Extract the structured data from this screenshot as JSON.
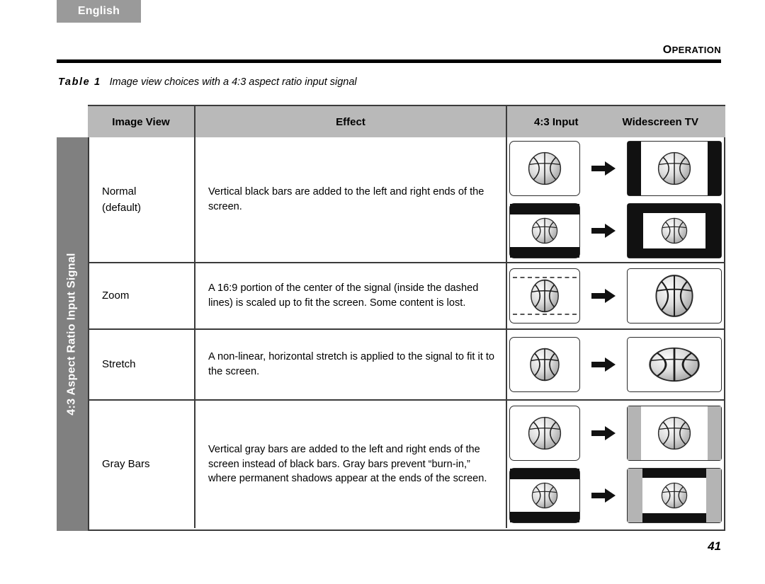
{
  "language_tab": {
    "label": "English"
  },
  "running_head": {
    "first_letter": "O",
    "rest": "PERATION"
  },
  "caption": {
    "label": "Table 1",
    "text": "Image view choices with a 4:3 aspect ratio input signal"
  },
  "table": {
    "side_label": "4:3 Aspect Ratio Input Signal",
    "headers": {
      "image_view": "Image View",
      "effect": "Effect",
      "input": "4:3 Input",
      "widescreen": "Widescreen TV"
    },
    "rows": [
      {
        "name_line1": "Normal",
        "name_line2": "(default)",
        "effect": "Vertical black bars are added to the left and right ends of the screen.",
        "figure": "normal-black-bars"
      },
      {
        "name_line1": "Zoom",
        "name_line2": "",
        "effect": "A 16:9 portion of the center of the signal (inside the dashed lines) is scaled up to fit the screen. Some content is lost.",
        "figure": "zoom-crop-scale"
      },
      {
        "name_line1": "Stretch",
        "name_line2": "",
        "effect": "A non-linear, horizontal stretch is applied to the signal to fit it to the screen.",
        "figure": "stretch-horizontal"
      },
      {
        "name_line1": "Gray Bars",
        "name_line2": "",
        "effect": "Vertical gray bars are added to the left and right ends of the screen instead of black bars. Gray bars prevent “burn-in,” where permanent shadows appear at the ends of the screen.",
        "figure": "gray-bars"
      }
    ]
  },
  "page_number": "41",
  "colors": {
    "language_tab_bg": "#9a9a9a",
    "header_row_bg": "#b9b9b9",
    "side_label_bg": "#808080",
    "border": "#3b3b3b",
    "black_bar": "#111111",
    "gray_bar": "#b4b4b4"
  }
}
